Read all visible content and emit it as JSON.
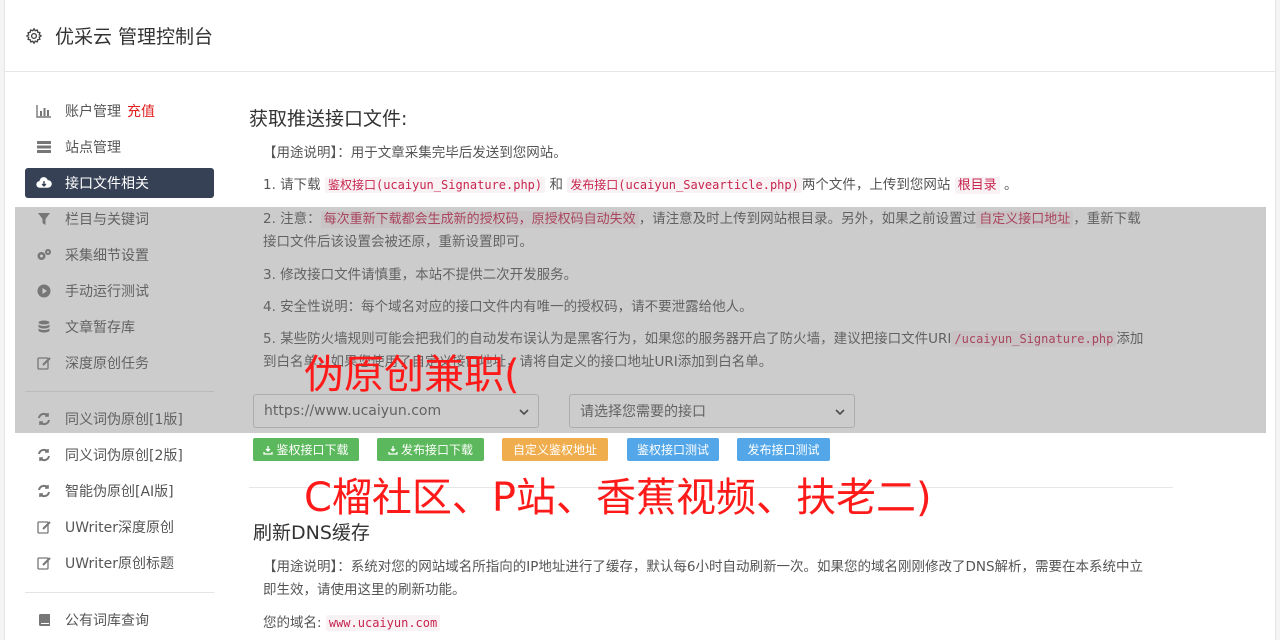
{
  "header": {
    "title": "优采云 管理控制台",
    "icon": "gear-icon"
  },
  "sidebar": {
    "items": [
      {
        "label": "账户管理",
        "extra": "充值",
        "icon": "bar-chart-icon"
      },
      {
        "label": "站点管理",
        "icon": "server-icon"
      },
      {
        "label": "接口文件相关",
        "icon": "cloud-download-icon",
        "active": true
      },
      {
        "label": "栏目与关键词",
        "icon": "filter-icon"
      },
      {
        "label": "采集细节设置",
        "icon": "gears-icon"
      },
      {
        "label": "手动运行测试",
        "icon": "play-circle-icon"
      },
      {
        "label": "文章暂存库",
        "icon": "database-icon"
      },
      {
        "label": "深度原创任务",
        "icon": "edit-icon"
      },
      {
        "label": "同义词伪原创[1版]",
        "icon": "refresh-icon"
      },
      {
        "label": "同义词伪原创[2版]",
        "icon": "refresh-icon"
      },
      {
        "label": "智能伪原创[AI版]",
        "icon": "refresh-icon"
      },
      {
        "label": "UWriter深度原创",
        "icon": "edit-icon"
      },
      {
        "label": "UWriter原创标题",
        "icon": "edit-icon"
      },
      {
        "label": "公有词库查询",
        "icon": "book-icon"
      }
    ]
  },
  "section1": {
    "title": "获取推送接口文件:",
    "usage_label": "【用途说明】",
    "usage_text": "：用于文章采集完毕后发送到您网站。",
    "item1": {
      "prefix": "1. 请下载",
      "link1": "鉴权接口(ucaiyun_Signature.php)",
      "and": "和",
      "link2": "发布接口(ucaiyun_Savearticle.php)",
      "mid": "两个文件，上传到您网站",
      "root": "根目录",
      "end": "。"
    },
    "item2": {
      "prefix": "2. 注意：",
      "warn": "每次重新下载都会生成新的授权码，原授权码自动失效",
      "mid": "，请注意及时上传到网站根目录。另外，如果之前设置过",
      "custom": "自定义接口地址",
      "end": "，重新下载接口文件后该设置会被还原，重新设置即可。"
    },
    "item3": "3. 修改接口文件请慎重，本站不提供二次开发服务。",
    "item4": "4. 安全性说明：每个域名对应的接口文件内有唯一的授权码，请不要泄露给他人。",
    "item5": {
      "prefix": "5. 某些防火墙规则可能会把我们的自动发布误认为是黑客行为，如果您的服务器开启了防火墙，建议把接口文件URI",
      "code": "/ucaiyun_Signature.php",
      "end": "添加到白名单，如果您使用了自定义接口地址，请将自定义的接口地址URI添加到白名单。"
    },
    "site_select": "https://www.ucaiyun.com",
    "interface_select": "请选择您需要的接口",
    "buttons": {
      "auth_download": "鉴权接口下载",
      "publish_download": "发布接口下载",
      "custom_auth": "自定义鉴权地址",
      "auth_test": "鉴权接口测试",
      "publish_test": "发布接口测试"
    }
  },
  "section2": {
    "title": "刷新DNS缓存",
    "usage_label": "【用途说明】",
    "usage_text": "：系统对您的网站域名所指向的IP地址进行了缓存，默认每6小时自动刷新一次。如果您的域名刚刚修改了DNS解析，需要在本系统中立即生效，请使用这里的刷新功能。",
    "domain_label": "您的域名:",
    "domain_value": "www.ucaiyun.com"
  },
  "overlay_text": {
    "line1": "伪原创兼职(",
    "line2": "C榴社区、P站、香蕉视频、扶老二)"
  },
  "colors": {
    "active_bg": "#364156",
    "green": "#5cb85c",
    "orange": "#f0ad4e",
    "blue": "#53a7e8",
    "highlight": "#c7254e",
    "recharge": "#e02020",
    "overlay_text": "#ff1a1a"
  }
}
